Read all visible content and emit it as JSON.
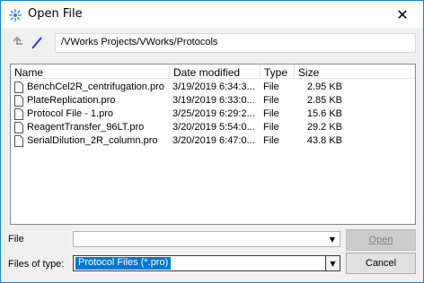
{
  "window": {
    "title": "Open File",
    "close_glyph": "✕"
  },
  "toolbar": {
    "path": "/VWorks Projects/VWorks/Protocols"
  },
  "columns": {
    "name": "Name",
    "date": "Date modified",
    "type": "Type",
    "size": "Size"
  },
  "files": [
    {
      "name": "BenchCel2R_centrifugation.pro",
      "date": "3/19/2019 6:34:3...",
      "type": "File",
      "size": "2.95 KB"
    },
    {
      "name": "PlateReplication.pro",
      "date": "3/19/2019 6:33:0...",
      "type": "File",
      "size": "2.85 KB"
    },
    {
      "name": "Protocol File - 1.pro",
      "date": "3/25/2019 6:29:2...",
      "type": "File",
      "size": "15.6 KB"
    },
    {
      "name": "ReagentTransfer_96LT.pro",
      "date": "3/20/2019 5:54:0...",
      "type": "File",
      "size": "29.2 KB"
    },
    {
      "name": "SerialDilution_2R_column.pro",
      "date": "3/20/2019 6:47:0...",
      "type": "File",
      "size": "43.8 KB"
    }
  ],
  "bottom": {
    "file_label": "File",
    "file_value": "",
    "filetype_label": "Files of type:",
    "filetype_value": "Protocol Files (*.pro)",
    "open_label": "Open",
    "cancel_label": "Cancel"
  },
  "icons": {
    "app": "app-icon",
    "close": "close-icon",
    "up": "up-arrow-icon",
    "nav": "slash-icon",
    "file": "file-icon",
    "dropdown": "chevron-down-icon"
  },
  "colors": {
    "accent": "#0078d7",
    "border": "#1883d7"
  }
}
